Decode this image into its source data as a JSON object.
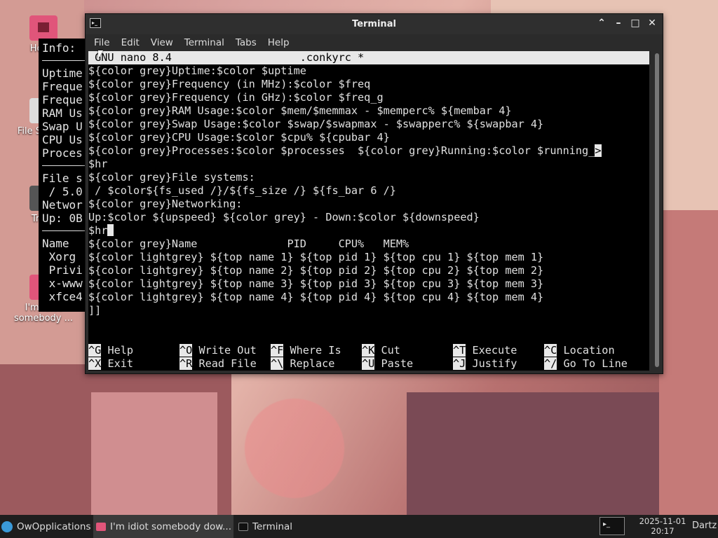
{
  "desktop": {
    "icons": [
      {
        "label": "Home"
      },
      {
        "label": "File System"
      },
      {
        "label": "Trash"
      },
      {
        "label": "I'm idiot somebody ..."
      }
    ]
  },
  "conky": {
    "title": "Info:",
    "stats": [
      "Uptime",
      "Freque",
      "Freque",
      "RAM Us",
      "Swap U",
      "CPU Us",
      "Proces"
    ],
    "fs": [
      "File s",
      " / 5.0",
      "Networ",
      "Up: 0B"
    ],
    "procs": [
      "Name",
      " Xorg",
      " Privi",
      " x-www",
      " xfce4"
    ]
  },
  "terminal": {
    "window_title": "Terminal",
    "menu": [
      "File",
      "Edit",
      "View",
      "Terminal",
      "Tabs",
      "Help"
    ],
    "nano_header": " GNU nano 8.4                    .conkyrc *",
    "lines": [
      "${color grey}Uptime:$color $uptime",
      "${color grey}Frequency (in MHz):$color $freq",
      "${color grey}Frequency (in GHz):$color $freq_g",
      "${color grey}RAM Usage:$color $mem/$memmax - $memperc% ${membar 4}",
      "${color grey}Swap Usage:$color $swap/$swapmax - $swapperc% ${swapbar 4}",
      "${color grey}CPU Usage:$color $cpu% ${cpubar 4}",
      "${color grey}Processes:$color $processes  ${color grey}Running:$color $running_",
      "$hr",
      "${color grey}File systems:",
      " / $color${fs_used /}/${fs_size /} ${fs_bar 6 /}",
      "${color grey}Networking:",
      "Up:$color ${upspeed} ${color grey} - Down:$color ${downspeed}",
      "$hr",
      "${color grey}Name              PID     CPU%   MEM%",
      "${color lightgrey} ${top name 1} ${top pid 1} ${top cpu 1} ${top mem 1}",
      "${color lightgrey} ${top name 2} ${top pid 2} ${top cpu 2} ${top mem 2}",
      "${color lightgrey} ${top name 3} ${top pid 3} ${top cpu 3} ${top mem 3}",
      "${color lightgrey} ${top name 4} ${top pid 4} ${top cpu 4} ${top mem 4}",
      "]]"
    ],
    "truncation_marker": ">",
    "shortcuts_row1": [
      {
        "key": "^G",
        "label": " Help"
      },
      {
        "key": "^O",
        "label": " Write Out"
      },
      {
        "key": "^F",
        "label": " Where Is"
      },
      {
        "key": "^K",
        "label": " Cut"
      },
      {
        "key": "^T",
        "label": " Execute"
      },
      {
        "key": "^C",
        "label": " Location"
      }
    ],
    "shortcuts_row2": [
      {
        "key": "^X",
        "label": " Exit"
      },
      {
        "key": "^R",
        "label": " Read File"
      },
      {
        "key": "^\\",
        "label": " Replace"
      },
      {
        "key": "^U",
        "label": " Paste"
      },
      {
        "key": "^J",
        "label": " Justify"
      },
      {
        "key": "^/",
        "label": " Go To Line"
      }
    ]
  },
  "taskbar": {
    "start_label": "OwOpplications",
    "windows": [
      "I'm idiot somebody dow...",
      "Terminal"
    ],
    "clock_date": "2025-11-01",
    "clock_time": "20:17",
    "user": "Dartz"
  },
  "colors": {
    "terminal_bg": "#000000",
    "terminal_fg": "#e0e0e0",
    "nano_bar": "#e8e8e8",
    "titlebar": "#2f2f2f",
    "taskbar": "#1e1e1e",
    "doc_icon": "#e0557a"
  }
}
